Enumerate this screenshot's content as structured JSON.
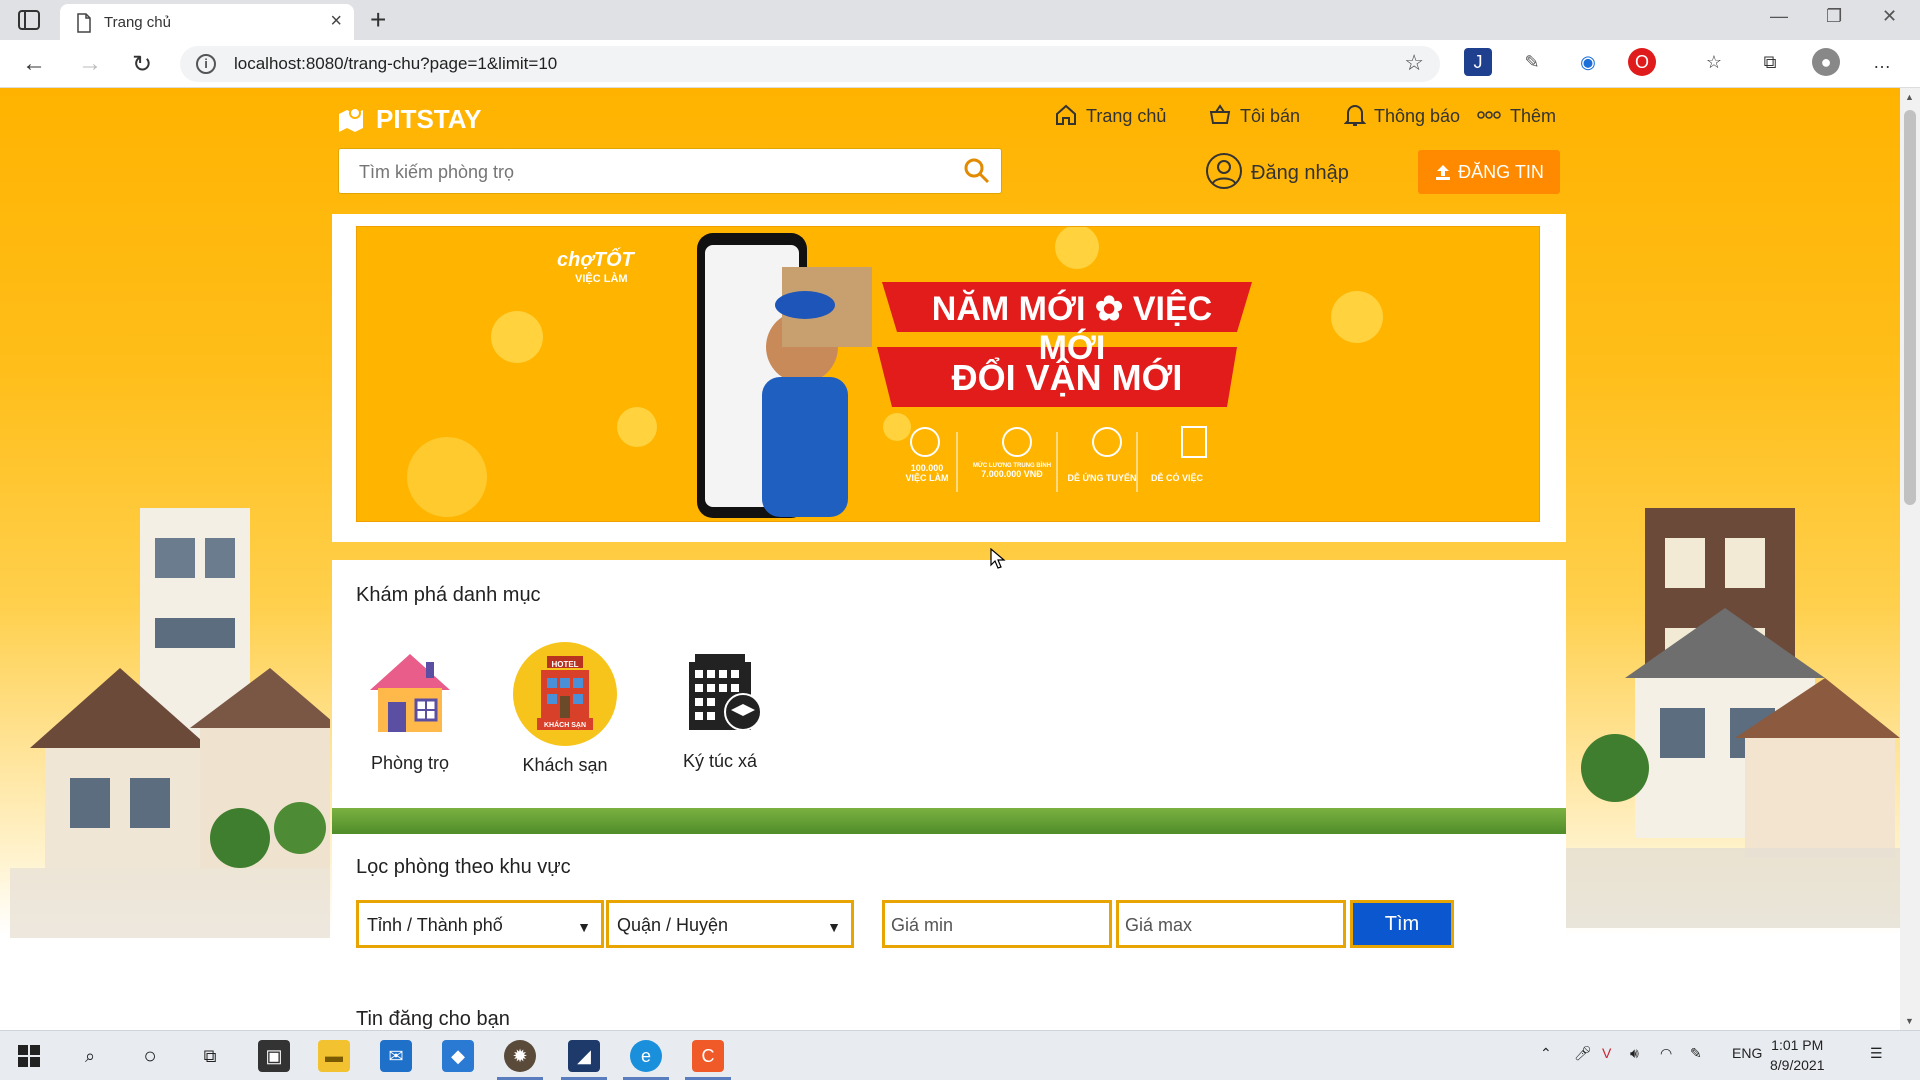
{
  "browser": {
    "tab_title": "Trang chủ",
    "url": "localhost:8080/trang-chu?page=1&limit=10"
  },
  "site": {
    "logo": "PITSTAY",
    "nav": [
      "Trang chủ",
      "Tôi bán",
      "Thông báo",
      "Thêm"
    ],
    "search_placeholder": "Tìm kiếm phòng trọ",
    "login": "Đăng nhập",
    "post_button": "ĐĂNG TIN"
  },
  "banner": {
    "brand_line1": "chợTỐT",
    "brand_line2": "VIỆC LÀM",
    "headline1": "NĂM MỚI ✿ VIỆC MỚI",
    "headline2": "ĐỔI VẬN MỚI",
    "features": [
      {
        "top": "100.000",
        "bottom": "VIỆC LÀM"
      },
      {
        "top": "MỨC LƯƠNG TRUNG BÌNH",
        "bottom": "7.000.000 VNĐ"
      },
      {
        "top": "",
        "bottom": "DỄ ỨNG TUYỂN"
      },
      {
        "top": "",
        "bottom": "DỄ CÓ VIỆC"
      }
    ]
  },
  "categories": {
    "title": "Khám phá danh mục",
    "items": [
      {
        "label": "Phòng trọ",
        "icon": "house-icon"
      },
      {
        "label": "Khách sạn",
        "icon": "hotel-icon",
        "badge_top": "HOTEL",
        "badge_bottom": "KHÁCH SẠN"
      },
      {
        "label": "Ký túc xá",
        "icon": "dormitory-icon"
      }
    ]
  },
  "filter": {
    "title": "Lọc phòng theo khu vực",
    "province": "Tỉnh / Thành phố",
    "district": "Quận / Huyện",
    "price_min_placeholder": "Giá min",
    "price_max_placeholder": "Giá max",
    "search_button": "Tìm"
  },
  "next_section": "Tin đăng cho bạn",
  "taskbar": {
    "language": "ENG",
    "time": "1:01 PM",
    "date": "8/9/2021"
  },
  "colors": {
    "brand_orange": "#ffb300",
    "post_button": "#ff8a00",
    "find_button": "#0b57d0",
    "border_gold": "#e8a400"
  }
}
